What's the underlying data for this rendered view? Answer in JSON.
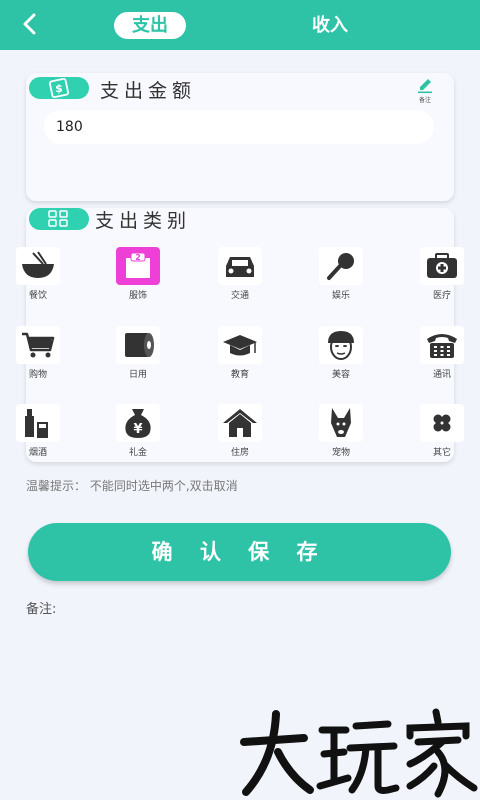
{
  "header": {
    "tab_expense": "支出",
    "tab_income": "收入"
  },
  "amount_section": {
    "title": "支出金额",
    "value": "180",
    "note_label": "备注"
  },
  "category_section": {
    "title": "支出类别",
    "items": [
      {
        "label": "餐饮",
        "icon": "noodle-bowl-icon"
      },
      {
        "label": "服饰",
        "icon": "clothing-icon"
      },
      {
        "label": "交通",
        "icon": "car-icon"
      },
      {
        "label": "娱乐",
        "icon": "microphone-icon"
      },
      {
        "label": "医疗",
        "icon": "medical-kit-icon"
      },
      {
        "label": "购物",
        "icon": "shopping-cart-icon"
      },
      {
        "label": "日用",
        "icon": "tissue-roll-icon"
      },
      {
        "label": "教育",
        "icon": "graduation-cap-icon"
      },
      {
        "label": "美容",
        "icon": "face-mask-icon"
      },
      {
        "label": "通讯",
        "icon": "telephone-icon"
      },
      {
        "label": "烟酒",
        "icon": "bottle-icon"
      },
      {
        "label": "礼金",
        "icon": "money-bag-icon"
      },
      {
        "label": "住房",
        "icon": "house-icon"
      },
      {
        "label": "宠物",
        "icon": "dog-icon"
      },
      {
        "label": "其它",
        "icon": "clover-icon"
      }
    ]
  },
  "hint": "温馨提示： 不能同时选中两个,双击取消",
  "save_button": "确 认 保 存",
  "remark_label": "备注:",
  "watermark": "大玩家",
  "colors": {
    "accent": "#2ec3a7",
    "selected_icon": "#ee3fd6"
  }
}
